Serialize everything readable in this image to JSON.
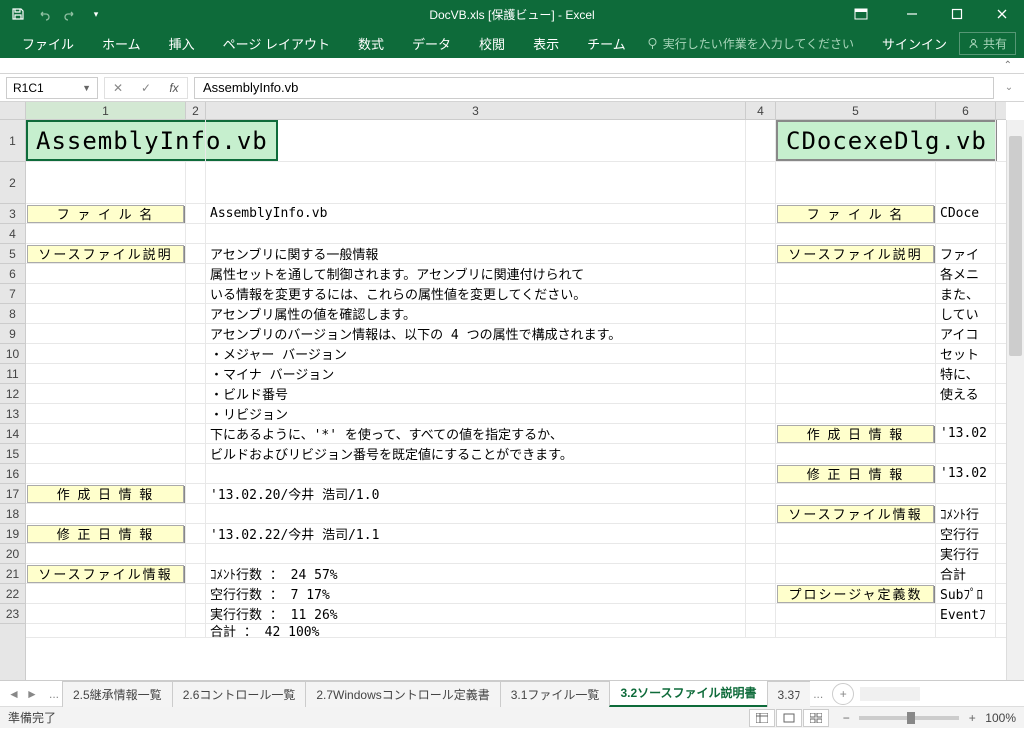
{
  "titlebar": {
    "title": "DocVB.xls [保護ビュー] - Excel"
  },
  "ribbon": {
    "tabs": [
      "ファイル",
      "ホーム",
      "挿入",
      "ページ レイアウト",
      "数式",
      "データ",
      "校閲",
      "表示",
      "チーム"
    ],
    "tell_me": "実行したい作業を入力してください",
    "signin": "サインイン",
    "share": "共有"
  },
  "namebox": {
    "ref": "R1C1"
  },
  "formula": {
    "value": "AssemblyInfo.vb"
  },
  "columns": [
    "1",
    "2",
    "3",
    "4",
    "5",
    "6"
  ],
  "rows": [
    "1",
    "2",
    "3",
    "4",
    "5",
    "6",
    "7",
    "8",
    "9",
    "10",
    "11",
    "12",
    "13",
    "14",
    "15",
    "16",
    "17",
    "18",
    "19",
    "20",
    "21",
    "22",
    "23"
  ],
  "left": {
    "title": "AssemblyInfo.vb",
    "labels": {
      "filename": "フ ァ イ ル 名",
      "source_desc": "ソースファイル説明",
      "create_info": "作 成 日 情 報",
      "modify_info": "修 正 日 情 報",
      "source_info": "ソースファイル情報"
    },
    "filename_val": "AssemblyInfo.vb",
    "desc": [
      "アセンブリに関する一般情報",
      "属性セットを通して制御されます。アセンブリに関連付けられて",
      "いる情報を変更するには、これらの属性値を変更してください。",
      "アセンブリ属性の値を確認します。",
      "アセンブリのバージョン情報は、以下の 4 つの属性で構成されます。",
      "・メジャー バージョン",
      "・マイナ バージョン",
      "・ビルド番号",
      "・リビジョン",
      "下にあるように、'*' を使って、すべての値を指定するか、",
      "ビルドおよびリビジョン番号を既定値にすることができます。"
    ],
    "create_val": "'13.02.20/今井 浩司/1.0",
    "modify_val": "'13.02.22/今井 浩司/1.1",
    "stats": [
      "ｺﾒﾝﾄ行数 ：    24    57%",
      "空行行数 ：     7    17%",
      "実行行数 ：    11    26%",
      "合計     ：    42   100%"
    ]
  },
  "right": {
    "title": "CDocexeDlg.vb",
    "labels": {
      "filename": "フ ァ イ ル 名",
      "source_desc": "ソースファイル説明",
      "create_info": "作 成 日 情 報",
      "modify_info": "修 正 日 情 報",
      "source_info": "ソースファイル情報",
      "proc_def": "プロシージャ定義数"
    },
    "vals": {
      "filename": "CDoce",
      "d1": "ファイ",
      "d2": "各メニ",
      "d3": "また、",
      "d4": "してい",
      "d5": "アイコ",
      "d6": "セット",
      "d7": "特に、",
      "d8": "使える",
      "create": "'13.02",
      "modify": "'13.02",
      "s1": "ｺﾒﾝﾄ行",
      "s2": "空行行",
      "s3": "実行行",
      "s4": "合計",
      "p1": "Subﾌﾟﾛ",
      "p2": "Eventﾌ"
    }
  },
  "sheets": {
    "tabs": [
      "2.5継承情報一覧",
      "2.6コントロール一覧",
      "2.7Windowsコントロール定義書",
      "3.1ファイル一覧",
      "3.2ソースファイル説明書",
      "3.3ﾌ"
    ],
    "active_index": 4,
    "ellipsis": "..."
  },
  "status": {
    "ready": "準備完了",
    "zoom": "100%"
  }
}
